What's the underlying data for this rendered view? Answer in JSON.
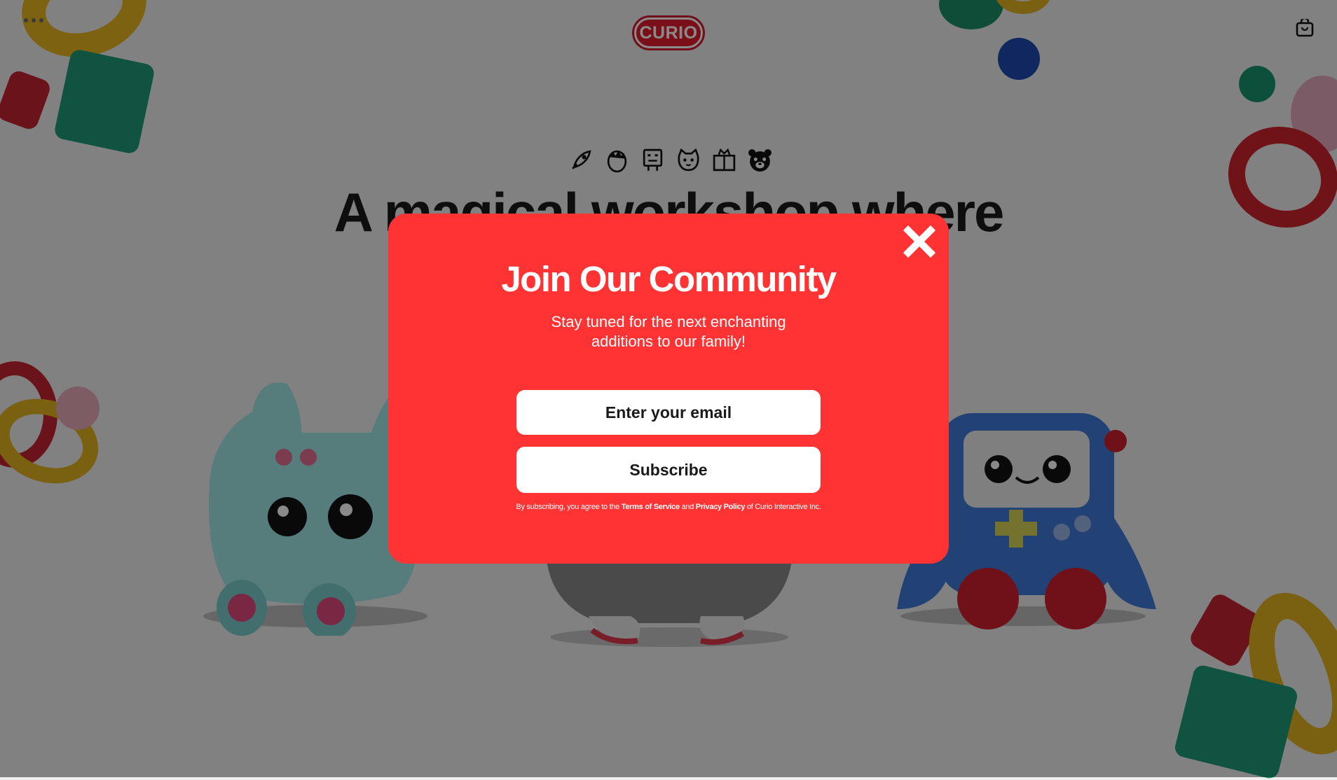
{
  "brand": {
    "logo_text": "CURIO"
  },
  "header": {
    "menu_icon": "ellipsis-icon",
    "cart_icon": "shopping-bag-icon"
  },
  "hero": {
    "icons": [
      "rocket-icon",
      "hair-face-icon",
      "robot-icon",
      "cat-icon",
      "book-icon",
      "bear-icon"
    ],
    "title": "A magical workshop where"
  },
  "modal": {
    "title": "Join Our Community",
    "subtitle": "Stay tuned for the next enchanting additions to our family!",
    "email_placeholder": "Enter your email",
    "subscribe_label": "Subscribe",
    "close_icon": "close-icon",
    "legal": {
      "prefix": "By subscribing, you agree to the",
      "terms": "Terms of Service",
      "and": "and",
      "privacy": "Privacy Policy",
      "suffix": "of Curio Interactive Inc."
    }
  },
  "colors": {
    "modal_bg": "#ff3333",
    "brand_red": "#e31d2f",
    "overlay": "rgba(0,0,0,0.46)",
    "text_dark": "#1a1a1a"
  }
}
